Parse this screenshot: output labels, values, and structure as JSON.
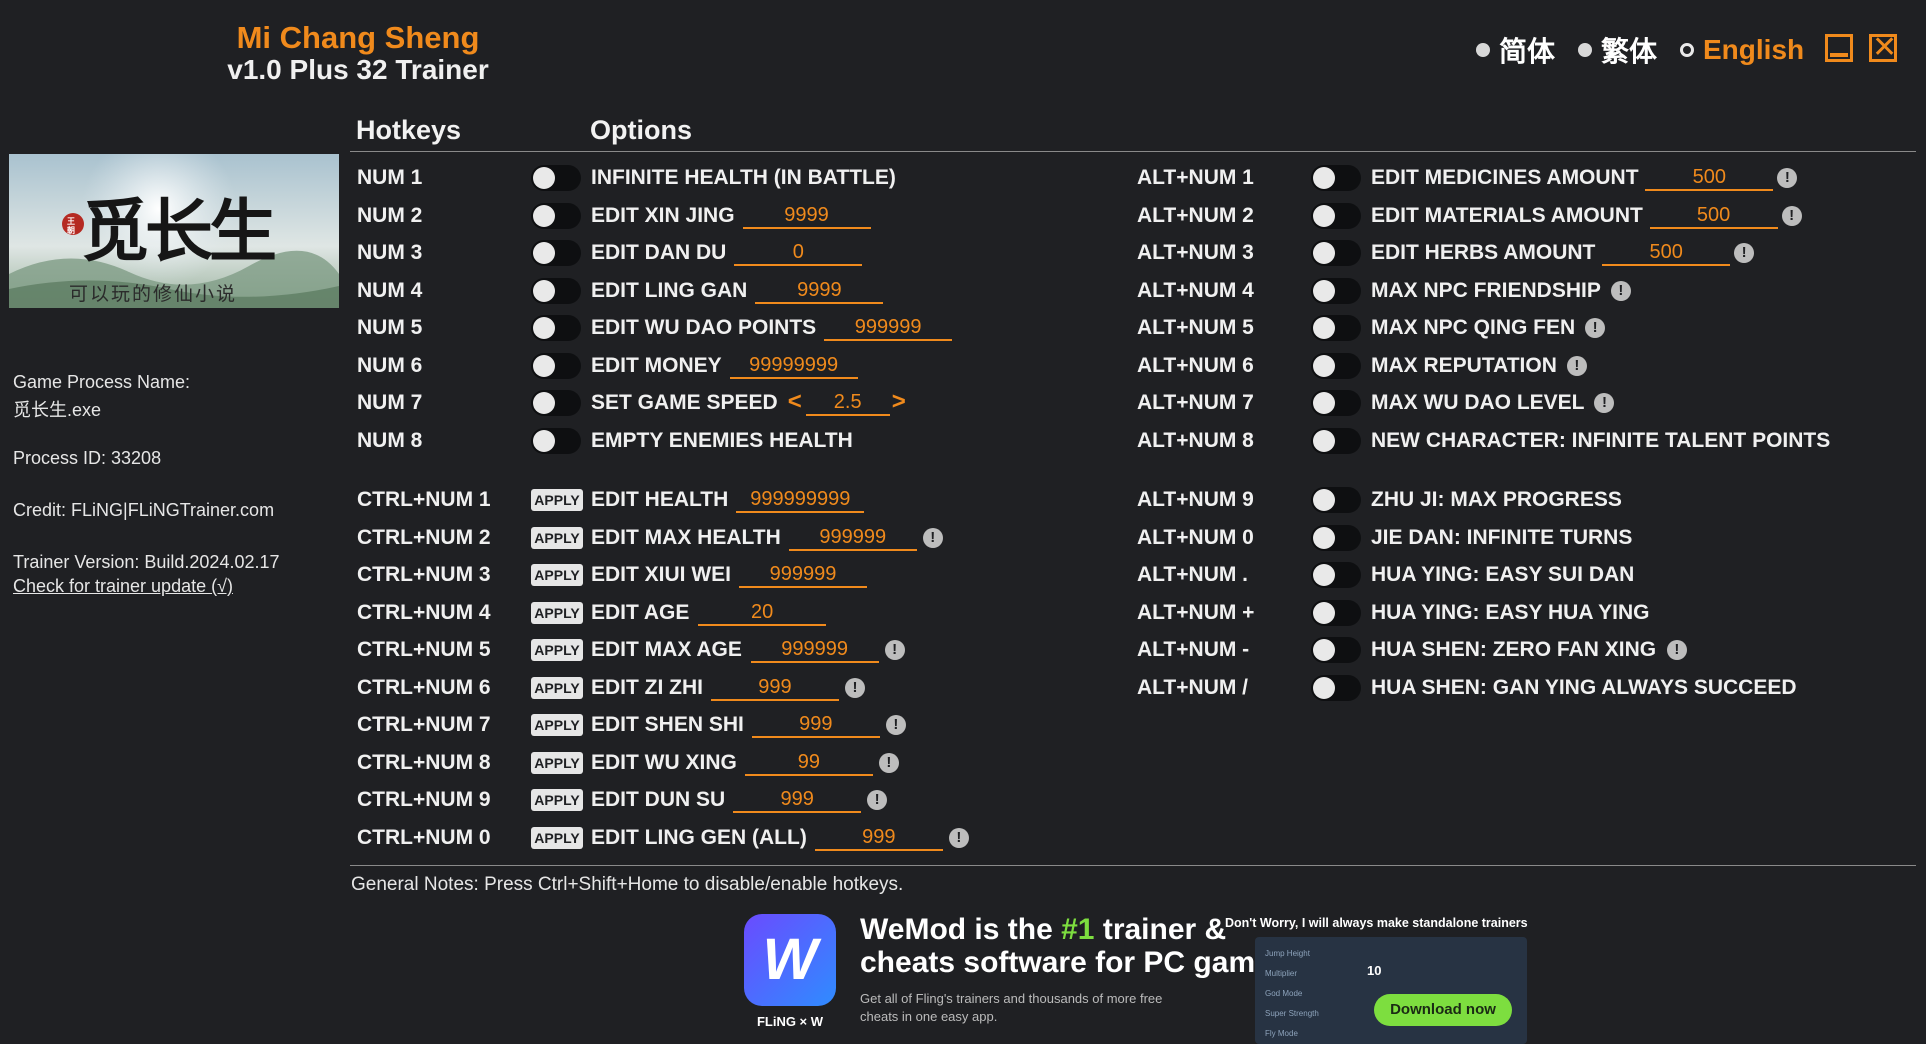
{
  "header": {
    "game_title": "Mi Chang Sheng",
    "trainer_title": "v1.0 Plus 32 Trainer",
    "languages": [
      {
        "label": "简体",
        "selected": false
      },
      {
        "label": "繁体",
        "selected": false
      },
      {
        "label": "English",
        "selected": true
      }
    ],
    "minimize_icon": "minimize-icon",
    "close_icon": "close-icon",
    "close_glyph": "✕",
    "accent_color": "#f08a1c"
  },
  "sidebar": {
    "cover_title": "觅长生",
    "cover_subtitle": "可以玩的修仙小说",
    "cover_seal": "王朝",
    "process_name_label": "Game Process Name:",
    "process_name": "觅长生.exe",
    "process_id": "Process ID: 33208",
    "credit": "Credit: FLiNG|FLiNGTrainer.com",
    "trainer_version": "Trainer Version: Build.2024.02.17",
    "update_link": "Check for trainer update (√)"
  },
  "columns": {
    "hotkeys": "Hotkeys",
    "options": "Options"
  },
  "left_options": [
    {
      "hotkey": "NUM 1",
      "control": "toggle",
      "label": "INFINITE HEALTH (IN BATTLE)"
    },
    {
      "hotkey": "NUM 2",
      "control": "toggle",
      "label": "EDIT XIN JING",
      "value": "9999"
    },
    {
      "hotkey": "NUM 3",
      "control": "toggle",
      "label": "EDIT DAN DU",
      "value": "0"
    },
    {
      "hotkey": "NUM 4",
      "control": "toggle",
      "label": "EDIT LING GAN",
      "value": "9999"
    },
    {
      "hotkey": "NUM 5",
      "control": "toggle",
      "label": "EDIT WU DAO POINTS",
      "value": "999999"
    },
    {
      "hotkey": "NUM 6",
      "control": "toggle",
      "label": "EDIT MONEY",
      "value": "99999999"
    },
    {
      "hotkey": "NUM 7",
      "control": "toggle",
      "label": "SET GAME SPEED",
      "value": "2.5",
      "arrows": true
    },
    {
      "hotkey": "NUM 8",
      "control": "toggle",
      "label": "EMPTY ENEMIES HEALTH"
    },
    {
      "hotkey": "CTRL+NUM 1",
      "control": "apply",
      "label": "EDIT HEALTH",
      "value": "999999999"
    },
    {
      "hotkey": "CTRL+NUM 2",
      "control": "apply",
      "label": "EDIT MAX HEALTH",
      "value": "999999",
      "info": true
    },
    {
      "hotkey": "CTRL+NUM 3",
      "control": "apply",
      "label": "EDIT XIUI WEI",
      "value": "999999"
    },
    {
      "hotkey": "CTRL+NUM 4",
      "control": "apply",
      "label": "EDIT AGE",
      "value": "20"
    },
    {
      "hotkey": "CTRL+NUM 5",
      "control": "apply",
      "label": "EDIT MAX AGE",
      "value": "999999",
      "info": true
    },
    {
      "hotkey": "CTRL+NUM 6",
      "control": "apply",
      "label": "EDIT ZI ZHI",
      "value": "999",
      "info": true
    },
    {
      "hotkey": "CTRL+NUM 7",
      "control": "apply",
      "label": "EDIT SHEN SHI",
      "value": "999",
      "info": true
    },
    {
      "hotkey": "CTRL+NUM 8",
      "control": "apply",
      "label": "EDIT WU XING",
      "value": "99",
      "info": true
    },
    {
      "hotkey": "CTRL+NUM 9",
      "control": "apply",
      "label": "EDIT DUN SU",
      "value": "999",
      "info": true
    },
    {
      "hotkey": "CTRL+NUM 0",
      "control": "apply",
      "label": "EDIT LING GEN (ALL)",
      "value": "999",
      "info": true
    }
  ],
  "right_options": [
    {
      "hotkey": "ALT+NUM 1",
      "label": "EDIT MEDICINES AMOUNT",
      "value": "500",
      "info": true
    },
    {
      "hotkey": "ALT+NUM 2",
      "label": "EDIT MATERIALS AMOUNT",
      "value": "500",
      "info": true
    },
    {
      "hotkey": "ALT+NUM 3",
      "label": "EDIT HERBS AMOUNT",
      "value": "500",
      "info": true
    },
    {
      "hotkey": "ALT+NUM 4",
      "label": "MAX NPC FRIENDSHIP",
      "info": true
    },
    {
      "hotkey": "ALT+NUM 5",
      "label": "MAX NPC QING FEN",
      "info": true
    },
    {
      "hotkey": "ALT+NUM 6",
      "label": "MAX REPUTATION",
      "info": true
    },
    {
      "hotkey": "ALT+NUM 7",
      "label": "MAX WU DAO LEVEL",
      "info": true
    },
    {
      "hotkey": "ALT+NUM 8",
      "label": "NEW CHARACTER: INFINITE TALENT POINTS"
    },
    {
      "hotkey": "ALT+NUM 9",
      "label": "ZHU JI: MAX PROGRESS"
    },
    {
      "hotkey": "ALT+NUM 0",
      "label": "JIE DAN: INFINITE TURNS"
    },
    {
      "hotkey": "ALT+NUM .",
      "label": "HUA YING: EASY SUI DAN"
    },
    {
      "hotkey": "ALT+NUM +",
      "label": "HUA YING: EASY HUA YING"
    },
    {
      "hotkey": "ALT+NUM -",
      "label": "HUA SHEN: ZERO FAN XING",
      "info": true
    },
    {
      "hotkey": "ALT+NUM /",
      "label": "HUA SHEN: GAN YING ALWAYS SUCCEED"
    }
  ],
  "apply_label": "APPLY",
  "info_glyph": "!",
  "arrow_left": "<",
  "arrow_right": ">",
  "notes": "General Notes: Press Ctrl+Shift+Home to disable/enable hotkeys.",
  "ad": {
    "logo_letter": "W",
    "brand_line": "FLiNG × W",
    "headline_pre": "WeMod is the ",
    "headline_highlight": "#1",
    "headline_post": " trainer &",
    "headline_line2": "cheats software for PC games",
    "subtext": "Get all of Fling's trainers and thousands of more free cheats in one easy app.",
    "reassurance": "Don't Worry, I will always make standalone trainers",
    "download_label": "Download now",
    "preview_rows": [
      "Jump Height",
      "Multiplier",
      "God Mode",
      "Super Strength",
      "Fly Mode"
    ],
    "preview_value": "10"
  }
}
